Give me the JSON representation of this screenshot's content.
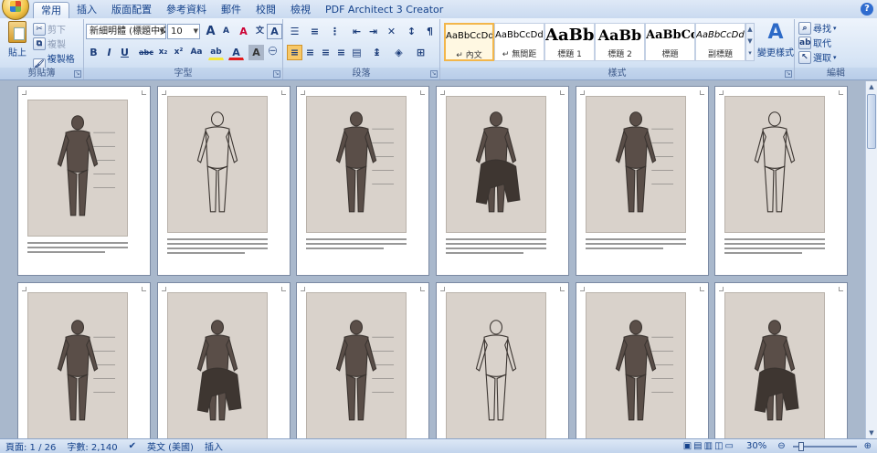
{
  "tabs": [
    {
      "label": "常用",
      "active": true
    },
    {
      "label": "插入"
    },
    {
      "label": "版面配置"
    },
    {
      "label": "參考資料"
    },
    {
      "label": "郵件"
    },
    {
      "label": "校閱"
    },
    {
      "label": "檢視"
    },
    {
      "label": "PDF Architect 3 Creator"
    }
  ],
  "help_icon": "?",
  "clipboard": {
    "paste": "貼上",
    "cut": "剪下",
    "copy": "複製",
    "format_painter": "複製格式",
    "label": "剪貼簿"
  },
  "font": {
    "name": "新細明體 (標題中文:",
    "size": "10",
    "label": "字型",
    "bold": "B",
    "italic": "I",
    "underline": "U",
    "strike": "abc",
    "sub": "x₂",
    "sup": "x²",
    "case": "Aa",
    "grow": "A",
    "shrink": "A",
    "clear": "A",
    "highlight": "ab",
    "color": "A",
    "phonetic": "A",
    "border_char": "A"
  },
  "paragraph": {
    "label": "段落"
  },
  "styles": {
    "label": "樣式",
    "items": [
      {
        "preview": "AaBbCcDdE",
        "name": "↵ 內文",
        "active": true
      },
      {
        "preview": "AaBbCcDdE",
        "name": "↵ 無間距"
      },
      {
        "preview": "AaBb",
        "name": "標題 1"
      },
      {
        "preview": "AaBb",
        "name": "標題 2"
      },
      {
        "preview": "AaBbCc",
        "name": "標題"
      },
      {
        "preview": "AaBbCcDdE",
        "name": "副標題"
      }
    ],
    "change_styles": "變更樣式"
  },
  "editing": {
    "find": "尋找",
    "replace": "取代",
    "select": "選取",
    "label": "編輯"
  },
  "status": {
    "page": "頁面: 1 / 26",
    "words": "字數: 2,140",
    "language": "英文 (美國)",
    "mode": "插入",
    "zoom": "30%"
  }
}
